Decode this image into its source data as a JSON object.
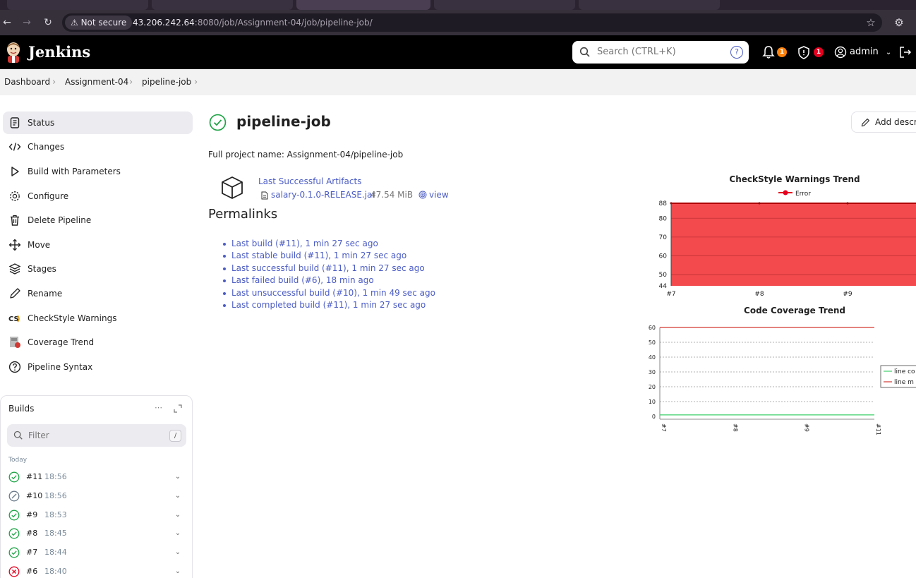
{
  "browser": {
    "not_secure": "Not secure",
    "url_host": "43.206.242.64",
    "url_path": ":8080/job/Assignment-04/job/pipeline-job/"
  },
  "header": {
    "brand": "Jenkins",
    "search_placeholder": "Search (CTRL+K)",
    "notifications_count": "1",
    "security_count": "1",
    "user": "admin"
  },
  "breadcrumb": [
    "Dashboard",
    "Assignment-04",
    "pipeline-job"
  ],
  "sidebar": {
    "items": [
      {
        "label": "Status",
        "icon": "document-icon",
        "active": true
      },
      {
        "label": "Changes",
        "icon": "code-icon"
      },
      {
        "label": "Build with Parameters",
        "icon": "play-icon"
      },
      {
        "label": "Configure",
        "icon": "gear-icon"
      },
      {
        "label": "Delete Pipeline",
        "icon": "trash-icon"
      },
      {
        "label": "Move",
        "icon": "move-icon"
      },
      {
        "label": "Stages",
        "icon": "layers-icon"
      },
      {
        "label": "Rename",
        "icon": "pencil-icon"
      },
      {
        "label": "CheckStyle Warnings",
        "icon": "checkstyle-icon"
      },
      {
        "label": "Coverage Trend",
        "icon": "coverage-icon"
      },
      {
        "label": "Pipeline Syntax",
        "icon": "help-icon"
      }
    ]
  },
  "builds": {
    "title": "Builds",
    "filter_placeholder": "Filter",
    "filter_key": "/",
    "group": "Today",
    "rows": [
      {
        "num": "#11",
        "time": "18:56",
        "status": "success"
      },
      {
        "num": "#10",
        "time": "18:56",
        "status": "aborted"
      },
      {
        "num": "#9",
        "time": "18:53",
        "status": "success"
      },
      {
        "num": "#8",
        "time": "18:45",
        "status": "success"
      },
      {
        "num": "#7",
        "time": "18:44",
        "status": "success"
      },
      {
        "num": "#6",
        "time": "18:40",
        "status": "failed"
      }
    ]
  },
  "main": {
    "title": "pipeline-job",
    "full_name": "Full project name: Assignment-04/pipeline-job",
    "add_description": "Add description",
    "artifacts": {
      "title": "Last Successful Artifacts",
      "file": "salary-0.1.0-RELEASE.jar",
      "size": "47.54 MiB",
      "view": "view"
    },
    "permalinks_title": "Permalinks",
    "permalinks": [
      "Last build (#11), 1 min 27 sec ago",
      "Last stable build (#11), 1 min 27 sec ago",
      "Last successful build (#11), 1 min 27 sec ago",
      "Last failed build (#6), 18 min ago",
      "Last unsuccessful build (#10), 1 min 49 sec ago",
      "Last completed build (#11), 1 min 27 sec ago"
    ]
  },
  "colors": {
    "accent": "#4b5cc4",
    "success": "#1ea446",
    "failed": "#e6001f",
    "badge_orange": "#fe820a",
    "badge_red": "#e6001f",
    "checkstyle_fill": "#f24a4d"
  },
  "chart_data": [
    {
      "type": "area",
      "title": "CheckStyle Warnings Trend",
      "legend": [
        "Error"
      ],
      "legend_position": "top",
      "categories": [
        "#7",
        "#8",
        "#9"
      ],
      "series": [
        {
          "name": "Error",
          "values": [
            88,
            88,
            88
          ]
        }
      ],
      "yticks": [
        44,
        50,
        60,
        70,
        80,
        88
      ],
      "ylim": [
        44,
        88
      ],
      "grid": true
    },
    {
      "type": "line",
      "title": "Code Coverage Trend",
      "categories": [
        "#7",
        "#8",
        "#9",
        "#11"
      ],
      "yticks": [
        0,
        10,
        20,
        30,
        40,
        50,
        60
      ],
      "ylim": [
        0,
        60
      ],
      "legend_position": "right",
      "series": [
        {
          "name": "line co",
          "values": [
            1,
            1,
            1,
            1
          ]
        },
        {
          "name": "line m",
          "values": [
            60,
            60,
            60,
            60
          ]
        }
      ],
      "grid": true
    }
  ]
}
